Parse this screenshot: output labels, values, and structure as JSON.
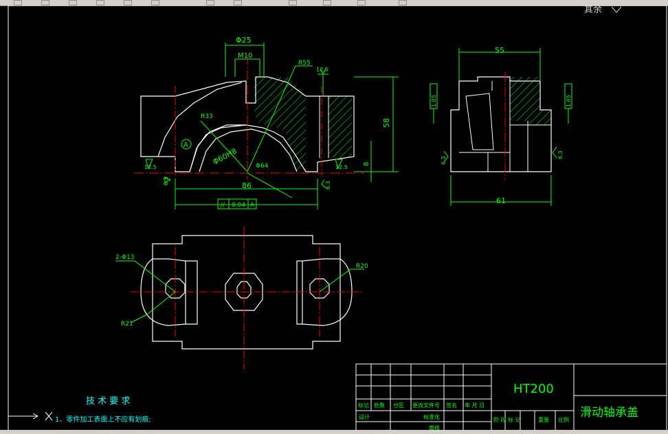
{
  "toolbar": {
    "right_label": "其余"
  },
  "dimensions": {
    "d25": "Φ25",
    "m10": "M10",
    "r55": "R55",
    "rough_top": "12.5",
    "r33": "R33",
    "datum_a": "A",
    "bore": "Φ60H8",
    "d64": "Φ64",
    "rough_left": "12.5",
    "rough_right": "12.5",
    "h58": "58",
    "h8": "8",
    "w86": "86",
    "rough_bottom_left": "6.3",
    "rough_bottom_right": "6.3",
    "parallel_symbol": "//",
    "parallel_tol": "0.04",
    "parallel_datum": "A",
    "w55": "55",
    "tol_left": "1.05",
    "tol_right": "1.05",
    "w61": "61",
    "rough_side_left": "6.3",
    "rough_side_right": "6.3",
    "hole": "2-Φ13",
    "r20": "R20",
    "r21": "R21"
  },
  "notes": {
    "title": "技 术 要 求",
    "item1": "1、零件加工表面上不应有划痕;"
  },
  "title_block": {
    "material": "HT200",
    "part_name": "滑动轴承盖",
    "headers": [
      "标记",
      "处数",
      "分区",
      "更改文件号",
      "签名",
      "年 月 日"
    ],
    "design": "设计",
    "standard": "标准化",
    "review": "审核",
    "stage": "阶 段 标 记",
    "weight": "重量",
    "scale": "比例"
  },
  "colors": {
    "outline": "#ffffff",
    "dimension": "#00ff00",
    "centerline": "#ff0000",
    "hatch": "#00ff00",
    "note": "#00ffff"
  }
}
